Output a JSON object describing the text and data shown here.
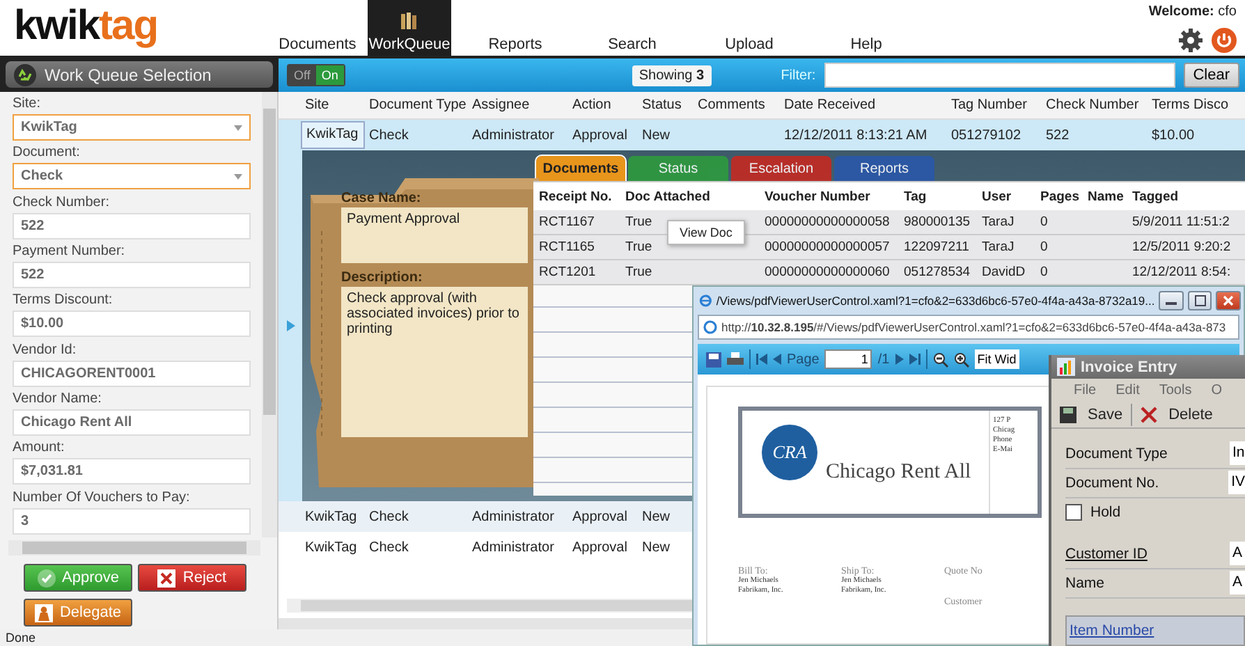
{
  "header": {
    "logo_prefix": "kwik",
    "logo_suffix": "tag",
    "welcome_label": "Welcome:",
    "user": "cfo"
  },
  "nav": [
    {
      "label": "Documents",
      "selected": false
    },
    {
      "label": "WorkQueue",
      "selected": true
    },
    {
      "label": "Reports",
      "selected": false
    },
    {
      "label": "Search",
      "selected": false
    },
    {
      "label": "Upload",
      "selected": false
    },
    {
      "label": "Help",
      "selected": false
    }
  ],
  "left_panel": {
    "title": "Work Queue Selection",
    "fields": [
      {
        "label": "Site:",
        "value": "KwikTag",
        "kind": "dropdown"
      },
      {
        "label": "Document:",
        "value": "Check",
        "kind": "dropdown"
      },
      {
        "label": "Check Number:",
        "value": "522",
        "kind": "text"
      },
      {
        "label": "Payment Number:",
        "value": "522",
        "kind": "text"
      },
      {
        "label": "Terms Discount:",
        "value": "$10.00",
        "kind": "text"
      },
      {
        "label": "Vendor Id:",
        "value": "CHICAGORENT0001",
        "kind": "text"
      },
      {
        "label": "Vendor Name:",
        "value": "Chicago Rent All",
        "kind": "text"
      },
      {
        "label": "Amount:",
        "value": "$7,031.81",
        "kind": "text"
      },
      {
        "label": "Number Of Vouchers to Pay:",
        "value": "3",
        "kind": "text"
      }
    ],
    "buttons": [
      {
        "label": "Approve",
        "kind": "approve"
      },
      {
        "label": "Reject",
        "kind": "reject"
      },
      {
        "label": "Delegate",
        "kind": "delegate"
      }
    ]
  },
  "toolbar": {
    "off_label": "Off",
    "on_label": "On",
    "on": true,
    "showing_label": "Showing",
    "showing_count": "3",
    "filter_label": "Filter:",
    "clear": "Clear"
  },
  "queue": {
    "columns": [
      "Site",
      "Document Type",
      "Assignee",
      "Action",
      "Status",
      "Comments",
      "Date Received",
      "Tag Number",
      "Check Number",
      "Terms Disco"
    ],
    "rows": [
      {
        "expanded": true,
        "site": "KwikTag",
        "document_type": "Check",
        "assignee": "Administrator",
        "action": "Approval",
        "status": "New",
        "date_received": "12/12/2011 8:13:21 AM",
        "tag_number": "051279102",
        "check_number": "522",
        "terms_discount": "$10.00"
      },
      {
        "expanded": false,
        "site": "KwikTag",
        "document_type": "Check",
        "assignee": "Administrator",
        "action": "Approval",
        "status": "New"
      },
      {
        "expanded": false,
        "site": "KwikTag",
        "document_type": "Check",
        "assignee": "Administrator",
        "action": "Approval",
        "status": "New"
      }
    ]
  },
  "detail": {
    "case_name_label": "Case Name:",
    "case_name": "Payment Approval",
    "description_label": "Description:",
    "description": "Check approval (with associated invoices) prior to printing",
    "tabs": [
      {
        "label": "Documents",
        "selected": true,
        "color": "#e8951c"
      },
      {
        "label": "Status",
        "selected": false,
        "color": "#2e9a3e"
      },
      {
        "label": "Escalation",
        "selected": false,
        "color": "#c42a22"
      },
      {
        "label": "Reports",
        "selected": false,
        "color": "#2a57a8"
      }
    ],
    "columns": [
      "Receipt No.",
      "Doc Attached",
      "Voucher Number",
      "Tag",
      "User",
      "Pages",
      "Name",
      "Tagged"
    ],
    "rows": [
      {
        "cells": [
          "RCT1167",
          "True",
          "00000000000000058",
          "980000135",
          "TaraJ",
          "0",
          "",
          "5/9/2011 11:51:2"
        ]
      },
      {
        "cells": [
          "RCT1165",
          "True",
          "00000000000000057",
          "122097211",
          "TaraJ",
          "0",
          "",
          "12/5/2011 9:20:2"
        ]
      },
      {
        "cells": [
          "RCT1201",
          "True",
          "00000000000000060",
          "051278534",
          "DavidD",
          "0",
          "",
          "12/12/2011 8:54:"
        ]
      }
    ],
    "context_menu": [
      "View Doc"
    ]
  },
  "pdf_window": {
    "title": "/Views/pdfViewerUserControl.xaml?1=cfo&2=633d6bc6-57e0-4f4a-a43a-8732a19...",
    "address": "http://**10.32.8.195**/#/Views/pdfViewerUserControl.xaml?1=cfo&2=633d6bc6-57e0-4f4a-a43a-873",
    "page_label": "Page",
    "page": "1",
    "page_total": "/1",
    "zoom": "Fit Wid",
    "document": {
      "logo": "CRA",
      "company": "Chicago Rent All",
      "address_lines": [
        "127 P",
        "Chicag",
        "Phone",
        "E-Mai"
      ],
      "bill_to_label": "Bill To:",
      "bill_to": [
        "Jen Michaels",
        "Fabrikam, Inc."
      ],
      "ship_to_label": "Ship To:",
      "ship_to": [
        "Jen Michaels",
        "Fabrikam, Inc."
      ],
      "quote_label": "Quote No",
      "customer_label": "Customer"
    }
  },
  "invoice_window": {
    "title": "Invoice Entry",
    "menu": [
      "File",
      "Edit",
      "Tools",
      "O"
    ],
    "save": "Save",
    "delete": "Delete",
    "fields": [
      {
        "label": "Document Type",
        "value": "In"
      },
      {
        "label": "Document No.",
        "value": "IV"
      }
    ],
    "hold_label": "Hold",
    "hold_checked": false,
    "fields2": [
      {
        "label": "Customer ID",
        "value": "A"
      },
      {
        "label": "Name",
        "value": "A"
      }
    ],
    "grid_header": "Item Number"
  },
  "status_bar": "Done"
}
